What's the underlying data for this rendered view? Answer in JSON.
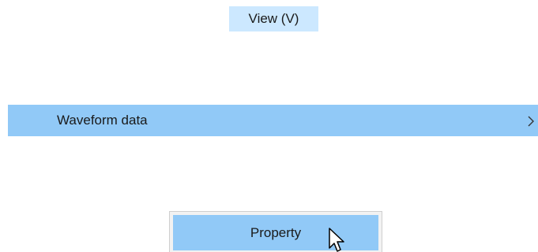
{
  "menu_bar": {
    "view_label": "View (V)"
  },
  "submenu": {
    "waveform_label": "Waveform data",
    "chevron_glyph": ">"
  },
  "context_menu": {
    "property_label": "Property"
  },
  "icons": {
    "submenu_arrow": "chevron-right-icon",
    "pointer": "mouse-cursor-icon"
  },
  "colors": {
    "menu_bar_hover": "#cce8ff",
    "menu_item_highlight": "#91c9f7",
    "text": "#1a1a1a"
  }
}
